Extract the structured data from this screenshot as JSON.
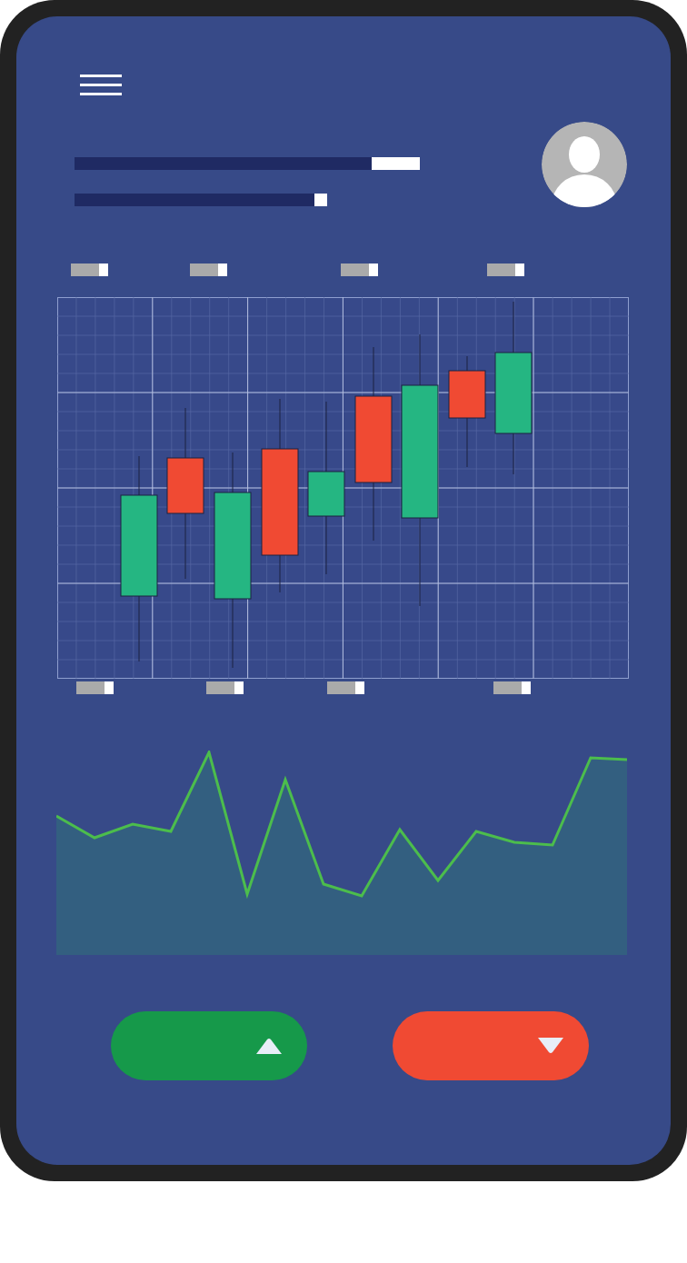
{
  "progress_bars": [
    {
      "level": 0.86
    },
    {
      "level": 0.95
    }
  ],
  "buttons": [
    {
      "kind": "up"
    },
    {
      "kind": "down"
    }
  ]
}
